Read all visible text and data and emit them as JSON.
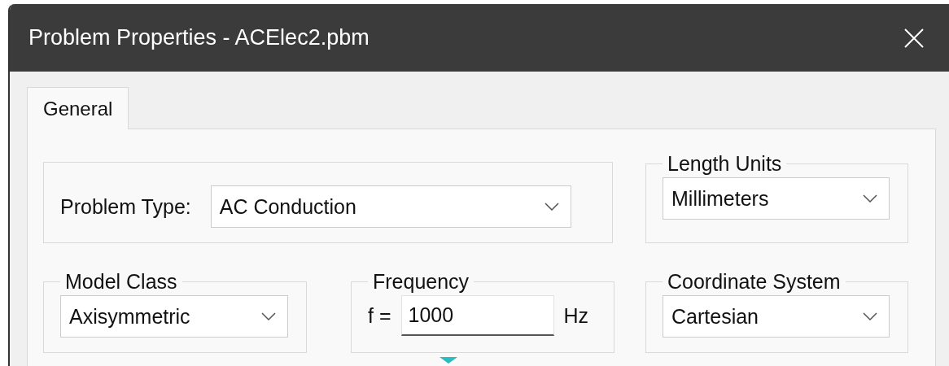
{
  "window": {
    "title": "Problem Properties - ACElec2.pbm"
  },
  "tabs": [
    {
      "label": "General",
      "selected": true
    }
  ],
  "problem_type": {
    "label": "Problem Type:",
    "value": "AC Conduction"
  },
  "length_units": {
    "title": "Length Units",
    "value": "Millimeters"
  },
  "model_class": {
    "title": "Model Class",
    "value": "Axisymmetric"
  },
  "frequency": {
    "title": "Frequency",
    "label": "f =",
    "value": "1000",
    "unit": "Hz"
  },
  "coordinate_system": {
    "title": "Coordinate System",
    "value": "Cartesian"
  }
}
